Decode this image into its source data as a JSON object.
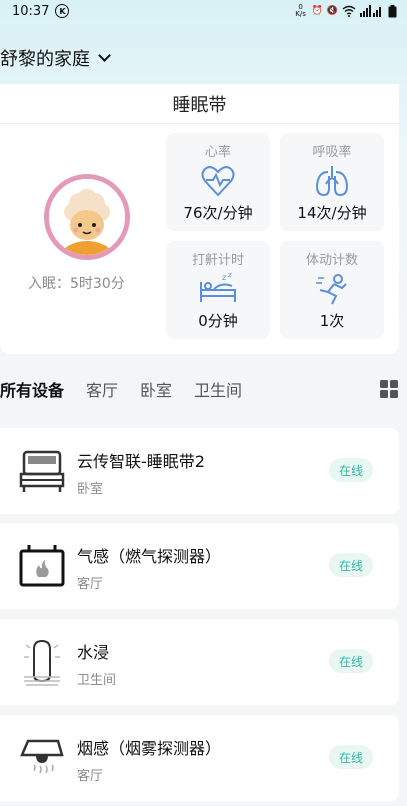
{
  "status_bar": {
    "time": "10:37",
    "speed": "0 K/s"
  },
  "home": {
    "name": "舒黎的家庭"
  },
  "sleep_card": {
    "title": "睡眠带",
    "sleep_time": "入眠：5时30分",
    "stats": [
      {
        "label": "心率",
        "value": "76次/分钟",
        "icon": "heart-icon"
      },
      {
        "label": "呼吸率",
        "value": "14次/分钟",
        "icon": "lungs-icon"
      },
      {
        "label": "打鼾计时",
        "value": "0分钟",
        "icon": "snore-bed-icon"
      },
      {
        "label": "体动计数",
        "value": "1次",
        "icon": "body-move-icon"
      }
    ]
  },
  "tabs": [
    "所有设备",
    "客厅",
    "卧室",
    "卫生间"
  ],
  "devices": [
    {
      "name": "云传智联-睡眠带2",
      "room": "卧室",
      "status": "在线",
      "icon": "bed-icon"
    },
    {
      "name": "气感（燃气探测器）",
      "room": "客厅",
      "status": "在线",
      "icon": "gas-detector-icon"
    },
    {
      "name": "水浸",
      "room": "卫生间",
      "status": "在线",
      "icon": "water-sensor-icon"
    },
    {
      "name": "烟感（烟雾探测器）",
      "room": "客厅",
      "status": "在线",
      "icon": "smoke-detector-icon"
    }
  ],
  "colors": {
    "accent": "#5b8fd9",
    "online_text": "#39b3a5",
    "online_bg": "#e8f6f4",
    "avatar_ring": "#e39ab8"
  }
}
